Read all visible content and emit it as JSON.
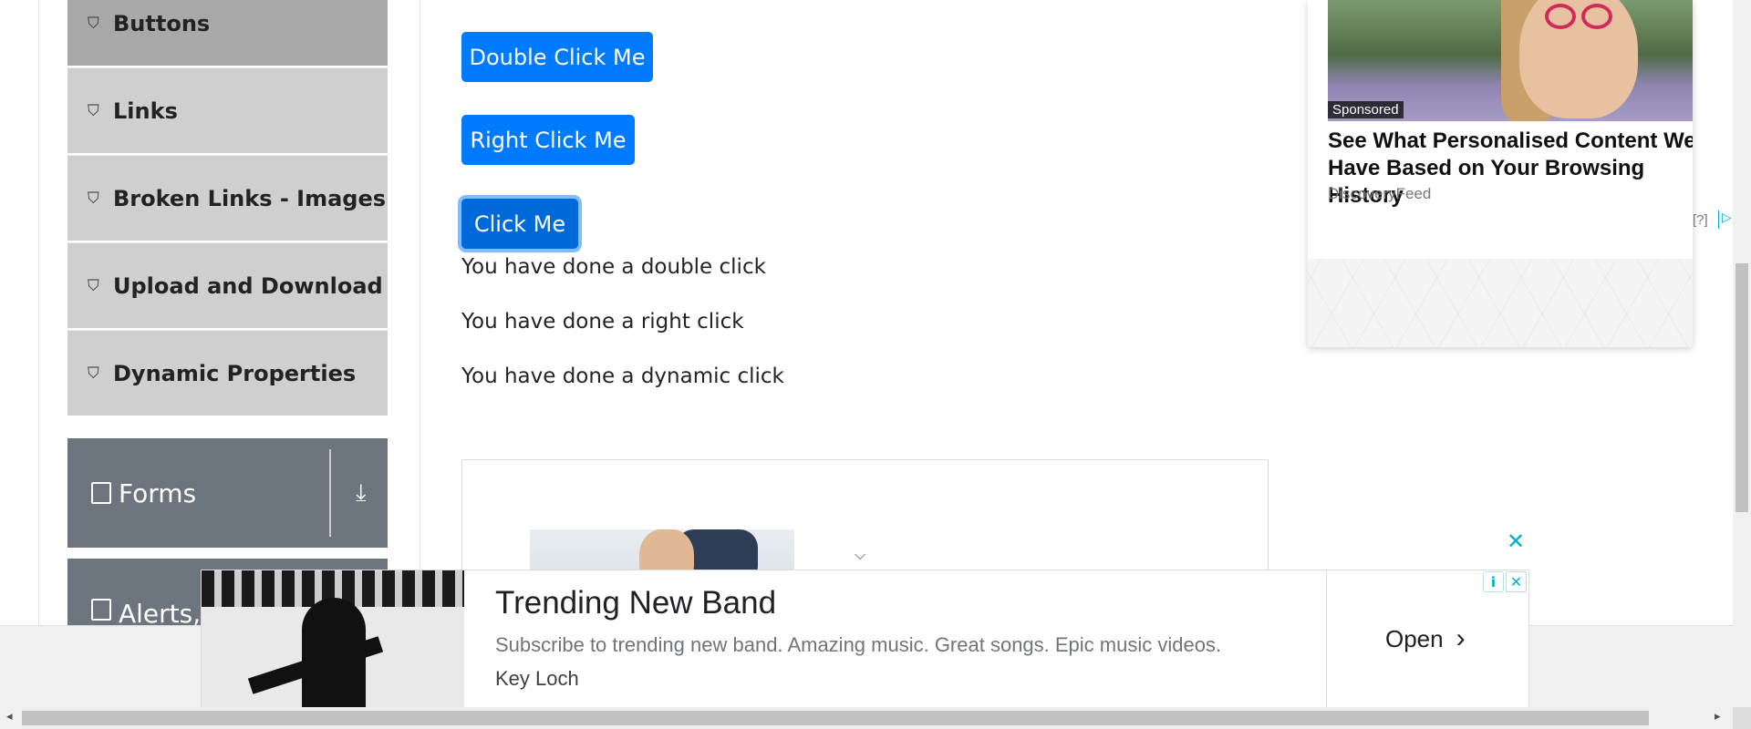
{
  "sidebar": {
    "items": [
      {
        "label": "Buttons",
        "icon": "html5-icon",
        "active": true
      },
      {
        "label": "Links",
        "icon": "html5-icon"
      },
      {
        "label": "Broken Links - Images",
        "icon": "html5-icon"
      },
      {
        "label": "Upload and Download",
        "icon": "html5-icon"
      },
      {
        "label": "Dynamic Properties",
        "icon": "html5-icon"
      }
    ],
    "groups": [
      {
        "label": "Forms",
        "icon": "document-icon",
        "toggle_icon": "download-arrow-icon"
      },
      {
        "label": "Alerts,",
        "icon": "window-icon"
      }
    ]
  },
  "main": {
    "buttons": {
      "double": "Double Click Me",
      "right": "Right Click Me",
      "click": "Click Me"
    },
    "messages": {
      "double": "You have done a double click",
      "right": "You have done a right click",
      "dynamic": "You have done a dynamic click"
    }
  },
  "ad_top": {
    "badge": "Sponsored",
    "headline": "See What Personalised Content We Have Based on Your Browsing History",
    "source": "DiscoveryFeed",
    "help": "[?]"
  },
  "banner": {
    "title": "Trending New Band",
    "subtitle": "Subscribe to trending new band. Amazing music. Great songs. Epic music videos.",
    "author": "Key Loch",
    "cta": "Open"
  },
  "colors": {
    "primary": "#007bff",
    "sidebar_bg": "#cfcfcf",
    "group_bg": "#6c757d",
    "ad_accent": "#00aecd"
  }
}
